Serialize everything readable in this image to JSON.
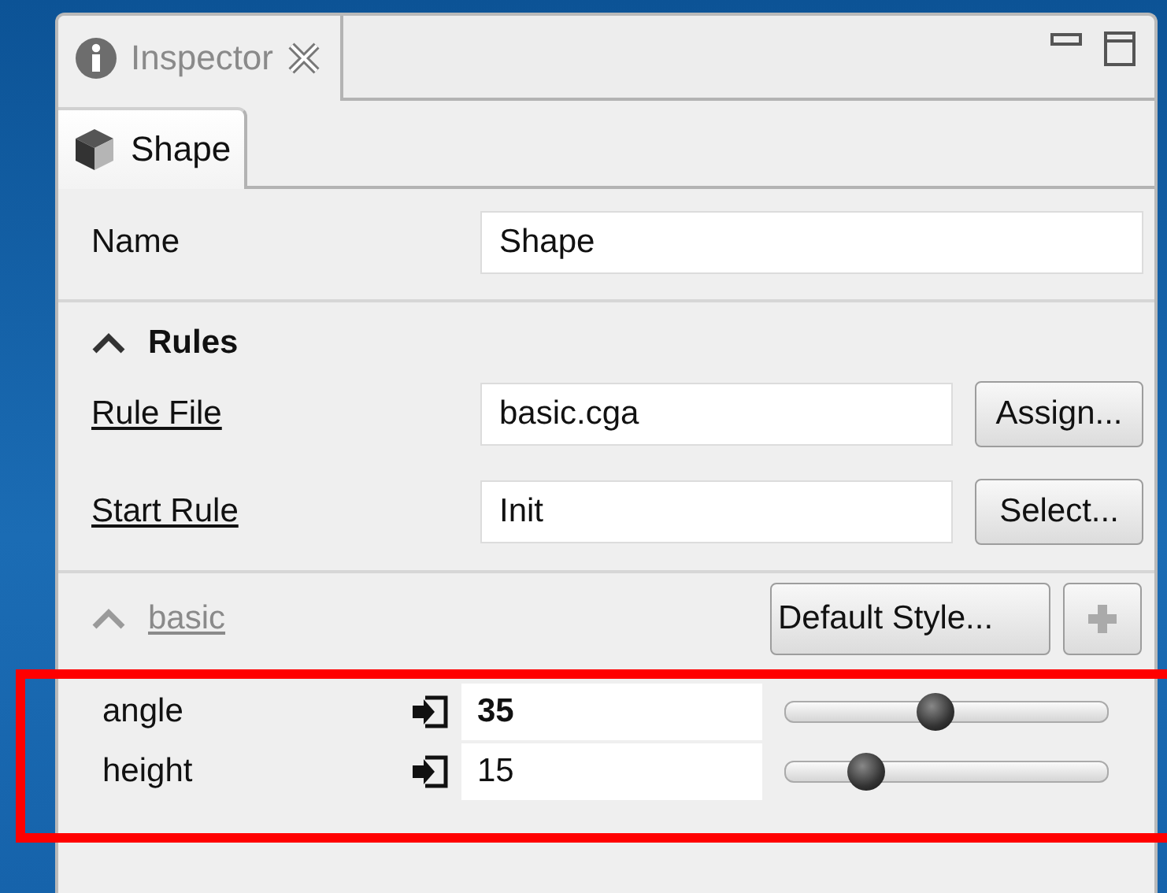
{
  "view_tab": {
    "title": "Inspector"
  },
  "sub_tab": {
    "title": "Shape"
  },
  "name_row": {
    "label": "Name",
    "value": "Shape"
  },
  "rules_section": {
    "title": "Rules",
    "expanded": true,
    "rows": [
      {
        "label": "Rule File",
        "value": "basic.cga",
        "button": "Assign..."
      },
      {
        "label": "Start Rule",
        "value": "Init",
        "button": "Select..."
      }
    ]
  },
  "style_section": {
    "title": "basic",
    "expanded": true,
    "disabled": true,
    "style_button": "Default Style..."
  },
  "attributes": [
    {
      "name": "angle",
      "value": "35",
      "user_set": true,
      "level": 0.46
    },
    {
      "name": "height",
      "value": "15",
      "user_set": false,
      "level": 0.22
    }
  ]
}
